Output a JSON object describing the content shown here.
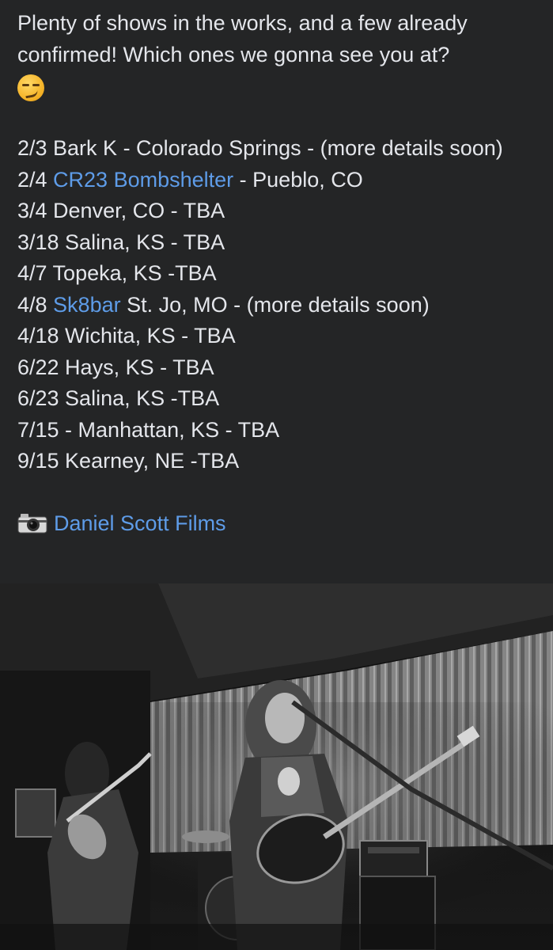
{
  "post": {
    "intro": "Plenty of shows in the works, and a few already confirmed! Which ones we gonna see you at?",
    "emoji_icon": "smirking-face-icon",
    "shows": [
      {
        "pre": "2/3 Bark K - Colorado Springs - (more details soon)",
        "link": "",
        "post": ""
      },
      {
        "pre": "2/4 ",
        "link": "CR23 Bombshelter",
        "post": " - Pueblo, CO"
      },
      {
        "pre": "3/4 Denver, CO - TBA",
        "link": "",
        "post": ""
      },
      {
        "pre": "3/18 Salina, KS - TBA",
        "link": "",
        "post": ""
      },
      {
        "pre": "4/7 Topeka, KS -TBA",
        "link": "",
        "post": ""
      },
      {
        "pre": "4/8 ",
        "link": "Sk8bar",
        "post": " St. Jo, MO - (more details soon)"
      },
      {
        "pre": "4/18 Wichita, KS - TBA",
        "link": "",
        "post": ""
      },
      {
        "pre": "6/22 Hays, KS - TBA",
        "link": "",
        "post": ""
      },
      {
        "pre": "6/23 Salina, KS -TBA",
        "link": "",
        "post": ""
      },
      {
        "pre": "7/15 - Manhattan, KS - TBA",
        "link": "",
        "post": ""
      },
      {
        "pre": "9/15 Kearney, NE -TBA",
        "link": "",
        "post": ""
      }
    ],
    "credit_icon": "camera-icon",
    "credit_link": "Daniel Scott Films"
  },
  "colors": {
    "background": "#242526",
    "text": "#e4e6eb",
    "link": "#5e9ce8"
  }
}
